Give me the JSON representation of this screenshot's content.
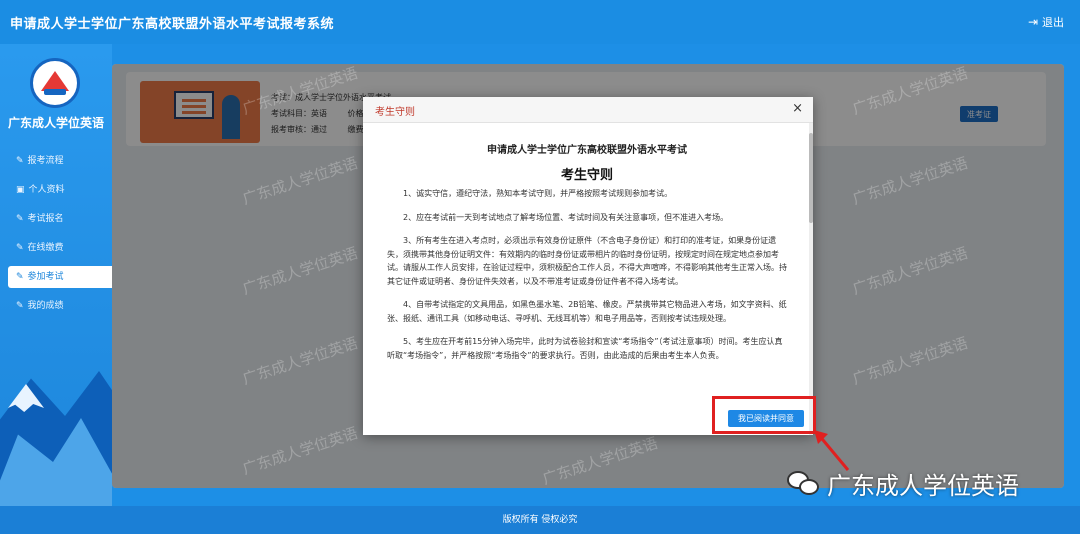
{
  "header": {
    "title": "申请成人学士学位广东高校联盟外语水平考试报考系统",
    "logout_label": "退出"
  },
  "sidebar": {
    "brand": "广东成人学位英语",
    "items": [
      {
        "label": "报考流程",
        "active": false
      },
      {
        "label": "个人资料",
        "active": false
      },
      {
        "label": "考试报名",
        "active": false
      },
      {
        "label": "在线缴费",
        "active": false
      },
      {
        "label": "参加考试",
        "active": true
      },
      {
        "label": "我的成绩",
        "active": false
      }
    ]
  },
  "exam_card": {
    "exam": "考试：成人学士学位外语水平考试",
    "subject": "考试科目：英语",
    "price": "价格：",
    "review": "报考审核：通过",
    "payment": "缴费状",
    "ticket_button": "准考证"
  },
  "modal": {
    "header_title": "考生守则",
    "organization": "申请成人学士学位广东高校联盟外语水平考试",
    "doc_title": "考生守则",
    "rules": [
      "1、诚实守信，遵纪守法，熟知本考试守则，并严格按照考试规则参加考试。",
      "2、应在考试前一天到考试地点了解考场位置、考试时间及有关注意事项，但不准进入考场。",
      "3、所有考生在进入考点时，必须出示有效身份证原件（不含电子身份证）和打印的准考证，如果身份证遗失，须携带其他身份证明文件：有效期内的临时身份证或带相片的临时身份证明，按规定时间在规定地点参加考试。请服从工作人员安排，在验证过程中，须积极配合工作人员，不得大声喧哗，不得影响其他考生正常入场。持其它证件或证明者、身份证件失效者，以及不带准考证或身份证件者不得入场考试。",
      "4、自带考试指定的文具用品，如黑色墨水笔、2B铅笔、橡皮。严禁携带其它物品进入考场，如文字资料、纸张、报纸、通讯工具（如移动电话、寻呼机、无线耳机等）和电子用品等，否则按考试违规处理。",
      "5、考生应在开考前15分钟入场完毕，此时为试卷验封和宣读“考场指令”（考试注意事项）时间。考生应认真听取“考场指令”，并严格按照“考场指令”的要求执行。否则，由此造成的后果由考生本人负责。"
    ],
    "agree_button": "我已阅读并同意"
  },
  "footer": {
    "copyright": "版权所有 侵权必究"
  },
  "badge": {
    "text": "广东成人学位英语"
  },
  "watermark": {
    "text": "广东成人学位英语"
  }
}
